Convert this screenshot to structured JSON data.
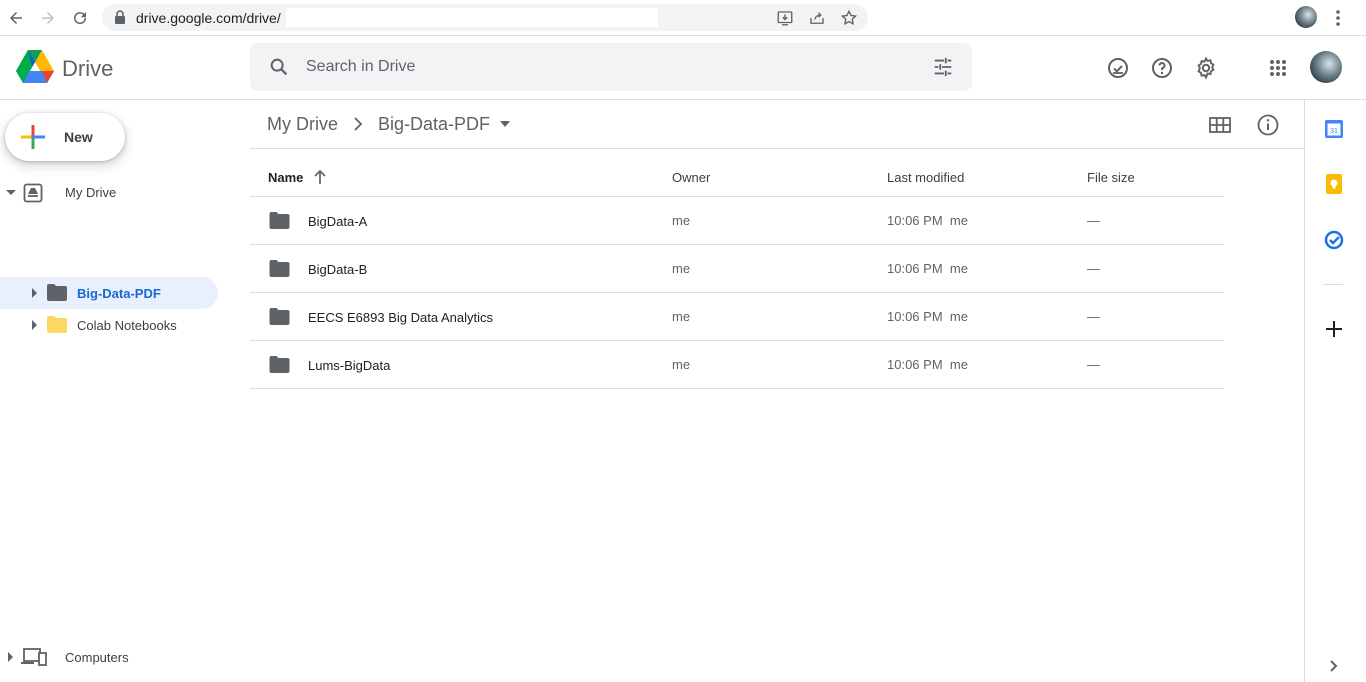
{
  "browser": {
    "url": "drive.google.com/drive/"
  },
  "header": {
    "app_name": "Drive",
    "search_placeholder": "Search in Drive"
  },
  "sidebar": {
    "new_label": "New",
    "my_drive_label": "My Drive",
    "folders": [
      {
        "label": "Big-Data-PDF",
        "selected": true,
        "color": "#5f6368"
      },
      {
        "label": "Colab Notebooks",
        "selected": false,
        "color": "#fdd663"
      }
    ],
    "computers_label": "Computers"
  },
  "breadcrumb": {
    "root": "My Drive",
    "current": "Big-Data-PDF"
  },
  "table": {
    "columns": [
      "Name",
      "Owner",
      "Last modified",
      "File size"
    ],
    "rows": [
      {
        "name": "BigData-A",
        "owner": "me",
        "modified": "10:06 PM  me",
        "size": "—"
      },
      {
        "name": "BigData-B",
        "owner": "me",
        "modified": "10:06 PM  me",
        "size": "—"
      },
      {
        "name": "EECS E6893 Big Data Analytics",
        "owner": "me",
        "modified": "10:06 PM  me",
        "size": "—"
      },
      {
        "name": "Lums-BigData",
        "owner": "me",
        "modified": "10:06 PM  me",
        "size": "—"
      }
    ]
  },
  "side_panel": {
    "calendar_day": "31"
  },
  "colors": {
    "accent": "#1967d2",
    "selected_bg": "#e8f0fe",
    "folder_grey": "#5f6368",
    "folder_yellow": "#fdd663"
  }
}
